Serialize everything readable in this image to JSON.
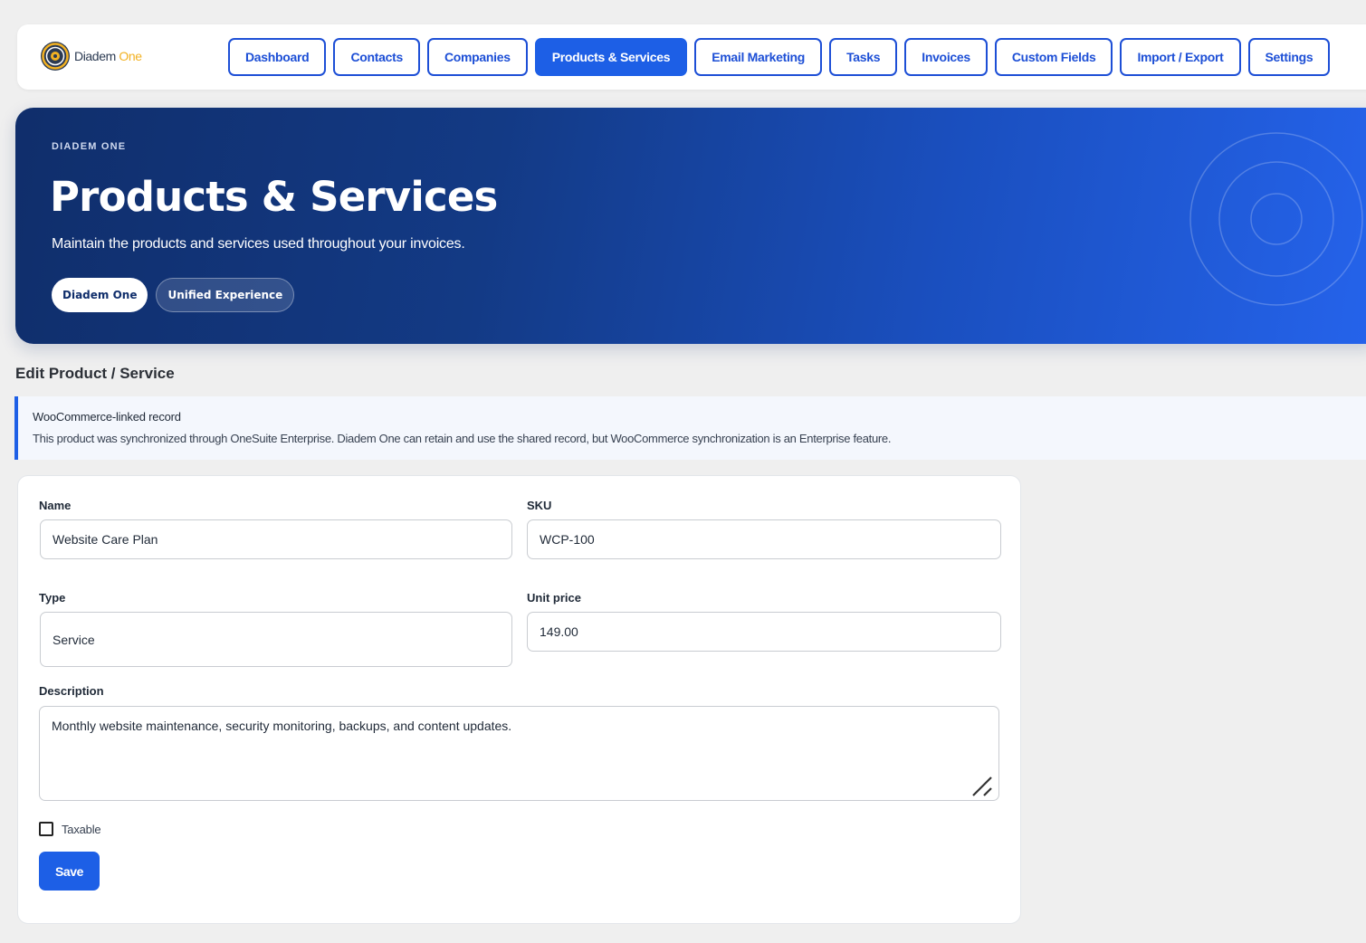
{
  "brand": {
    "name_main": "Diadem",
    "name_accent": "One",
    "accent_color": "#f2b122",
    "icon": "diadem-logo-icon"
  },
  "nav": {
    "items": [
      {
        "label": "Dashboard",
        "active": false
      },
      {
        "label": "Contacts",
        "active": false
      },
      {
        "label": "Companies",
        "active": false
      },
      {
        "label": "Products & Services",
        "active": true
      },
      {
        "label": "Email Marketing",
        "active": false
      },
      {
        "label": "Tasks",
        "active": false
      },
      {
        "label": "Invoices",
        "active": false
      },
      {
        "label": "Custom Fields",
        "active": false
      },
      {
        "label": "Import / Export",
        "active": false
      },
      {
        "label": "Settings",
        "active": false
      }
    ],
    "accent_color": "#1d5fe6"
  },
  "hero": {
    "kicker": "DIADEM ONE",
    "title": "Products & Services",
    "subtitle": "Maintain the products and services used throughout your invoices.",
    "pills": [
      "Diadem One",
      "Unified Experience"
    ],
    "decoration_icon": "concentric-rings-icon"
  },
  "section_title": "Edit Product / Service",
  "notice": {
    "title": "WooCommerce-linked record",
    "body": "This product was synchronized through OneSuite Enterprise. Diadem One can retain and use the shared record, but WooCommerce synchronization is an Enterprise feature."
  },
  "form": {
    "name_label": "Name",
    "name_value": "Website Care Plan",
    "sku_label": "SKU",
    "sku_value": "WCP-100",
    "type_label": "Type",
    "type_value": "Service",
    "price_label": "Unit price",
    "price_value": "149.00",
    "description_label": "Description",
    "description_value": "Monthly website maintenance, security monitoring, backups, and content updates.",
    "taxable_label": "Taxable",
    "taxable_checked": false,
    "save_label": "Save"
  }
}
